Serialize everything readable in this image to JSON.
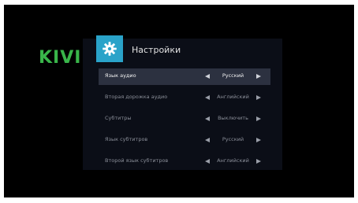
{
  "brand": "KIVI",
  "header": {
    "title": "Настройки",
    "icon": "gear-icon"
  },
  "rows": [
    {
      "label": "Язык аудио",
      "value": "Русский"
    },
    {
      "label": "Вторая дорожка аудио",
      "value": "Английский"
    },
    {
      "label": "Субтитры",
      "value": "Выключить"
    },
    {
      "label": "Язык субтитров",
      "value": "Русский"
    },
    {
      "label": "Второй язык субтитров",
      "value": "Английский"
    }
  ],
  "selected_index": 0,
  "colors": {
    "brand": "#39b54a",
    "accent": "#2aa3c9",
    "panel": "#0b0e17",
    "selected_row": "#2c3140"
  }
}
